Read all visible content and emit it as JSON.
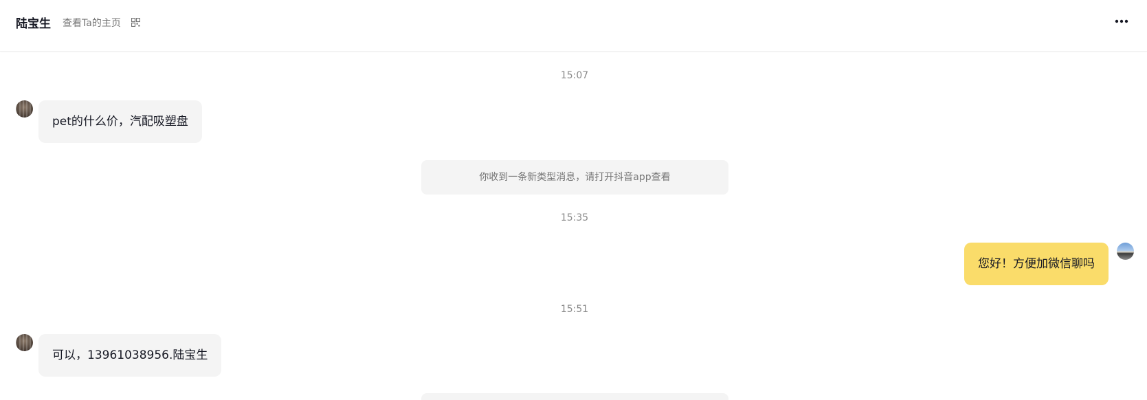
{
  "header": {
    "contact_name": "陆宝生",
    "profile_link": "查看Ta的主页",
    "qr_icon": "qr-code-icon",
    "more_icon": "more-horizontal-icon"
  },
  "messages": [
    {
      "type": "time",
      "text": "15:07"
    },
    {
      "type": "incoming",
      "text": "pet的什么价，汽配吸塑盘"
    },
    {
      "type": "notice",
      "text": "你收到一条新类型消息，请打开抖音app查看"
    },
    {
      "type": "time",
      "text": "15:35"
    },
    {
      "type": "outgoing",
      "text": "您好！方便加微信聊吗"
    },
    {
      "type": "time",
      "text": "15:51"
    },
    {
      "type": "incoming",
      "text": "可以，13961038956.陆宝生"
    }
  ],
  "colors": {
    "outgoing_bubble": "#fadc6a",
    "incoming_bubble": "#f4f4f4",
    "notice_bg": "#f4f4f4",
    "time_text": "#8a8a8a"
  }
}
